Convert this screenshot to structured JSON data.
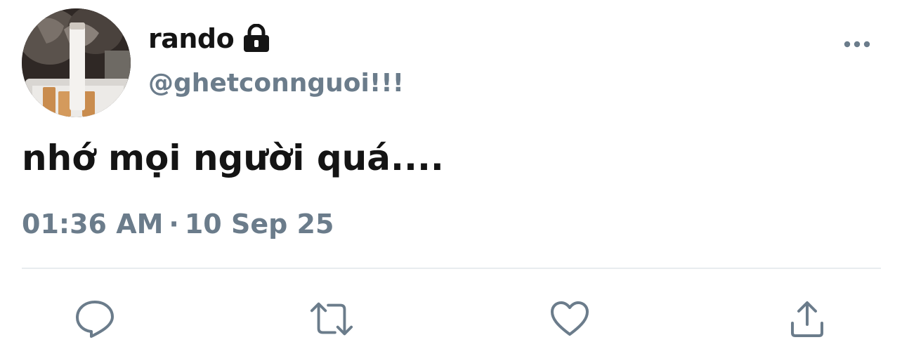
{
  "tweet": {
    "display_name": "rando",
    "handle": "@ghetconnguoi!!!",
    "text": "nhớ mọi người quá....",
    "time": "01:36 AM",
    "separator": "·",
    "date": "10 Sep 25"
  },
  "icons": {
    "protected": "lock-icon",
    "more": "more-horizontal-icon",
    "reply": "reply-icon",
    "retweet": "retweet-icon",
    "like": "heart-icon",
    "share": "share-icon"
  },
  "colors": {
    "text_primary": "#141414",
    "text_secondary": "#6b7c8b",
    "icon": "#6b7c8b",
    "divider": "#e8ecef"
  }
}
